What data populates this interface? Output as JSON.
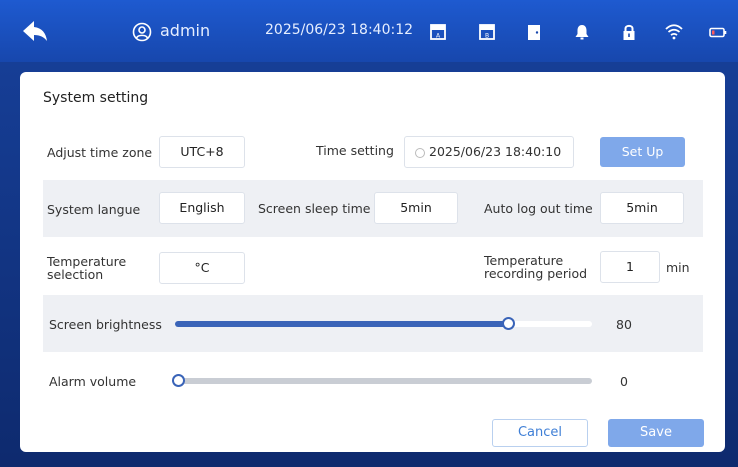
{
  "colors": {
    "topbar": "#1747ad",
    "accent": "#7fa8ea",
    "slider_fill": "#3a64b8",
    "row_shade": "#eef0f4"
  },
  "header": {
    "back_icon": "back-arrow-icon",
    "user_icon": "user-circle-icon",
    "username": "admin",
    "datetime": "2025/06/23 18:40:12",
    "icons": [
      "storage-a-icon",
      "storage-b-icon",
      "door-icon",
      "bell-icon",
      "lock-icon",
      "wifi-icon",
      "battery-icon"
    ]
  },
  "panel": {
    "title": "System setting",
    "timezone": {
      "label": "Adjust time zone",
      "value": "UTC+8"
    },
    "time_setting": {
      "label": "Time setting",
      "value": "2025/06/23 18:40:10",
      "button": "Set Up"
    },
    "language": {
      "label": "System langue",
      "value": "English"
    },
    "sleep": {
      "label": "Screen sleep time",
      "value": "5min"
    },
    "logout": {
      "label": "Auto log out time",
      "value": "5min"
    },
    "temp_unit": {
      "label_line1": "Temperature",
      "label_line2": "selection",
      "value": "°C"
    },
    "temp_period": {
      "label_line1": "Temperature",
      "label_line2": "recording period",
      "value": "1",
      "unit": "min"
    },
    "brightness": {
      "label": "Screen brightness",
      "value": "80",
      "level": 0.8
    },
    "volume": {
      "label": "Alarm volume",
      "value": "0",
      "level": 0
    },
    "cancel": "Cancel",
    "save": "Save"
  }
}
